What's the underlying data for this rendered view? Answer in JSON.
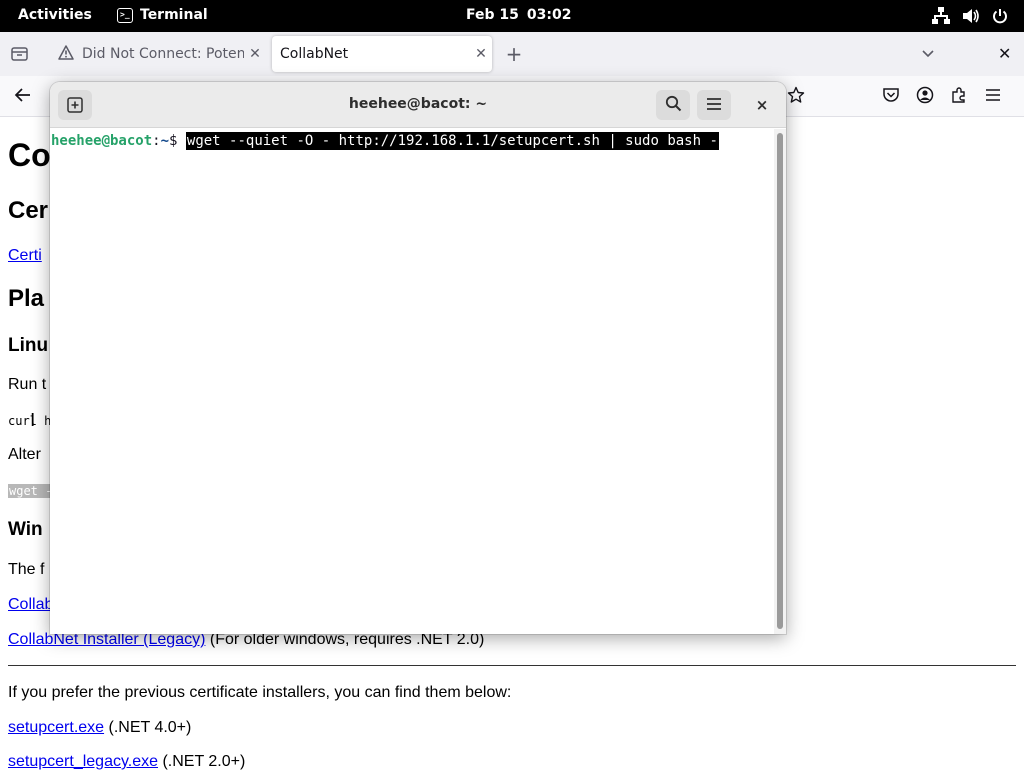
{
  "topbar": {
    "activities": "Activities",
    "app_name": "Terminal",
    "date": "Feb 15",
    "time": "03:02",
    "icons": [
      "network-icon",
      "volume-icon",
      "power-icon"
    ]
  },
  "browser": {
    "tabs": [
      {
        "title": "Did Not Connect: Potenti",
        "icon": "warning-icon",
        "active": false
      },
      {
        "title": "CollabNet",
        "icon": "",
        "active": true
      }
    ],
    "new_tab": "+",
    "close_window": "✕"
  },
  "page": {
    "h1": "Co",
    "h2_cert": "Cer",
    "cert_link": "Certi",
    "h2_platform": "Pla",
    "h3_linux": "Linu",
    "run_text": "Run t",
    "curl_code": "curl h",
    "alt_text": "Alter",
    "wget_code": "wget -",
    "h3_windows": "Win",
    "the_text": "The f",
    "collab_link_partial": "Collab",
    "legacy_link": "CollabNet Installer (Legacy)",
    "legacy_note": " (For older windows, requires .NET 2.0)",
    "prefer_text": "If you prefer the previous certificate installers, you can find them below:",
    "setupcert_link": "setupcert.exe",
    "setupcert_note": " (.NET 4.0+)",
    "setupcert_legacy_link": "setupcert_legacy.exe",
    "setupcert_legacy_note": " (.NET 2.0+)"
  },
  "terminal": {
    "title": "heehee@bacot: ~",
    "prompt_user": "heehee@bacot",
    "prompt_sep": ":",
    "prompt_path": "~",
    "prompt_symbol": "$ ",
    "command": "wget --quiet -O - http://192.168.1.1/setupcert.sh | sudo bash -",
    "close": "×"
  }
}
